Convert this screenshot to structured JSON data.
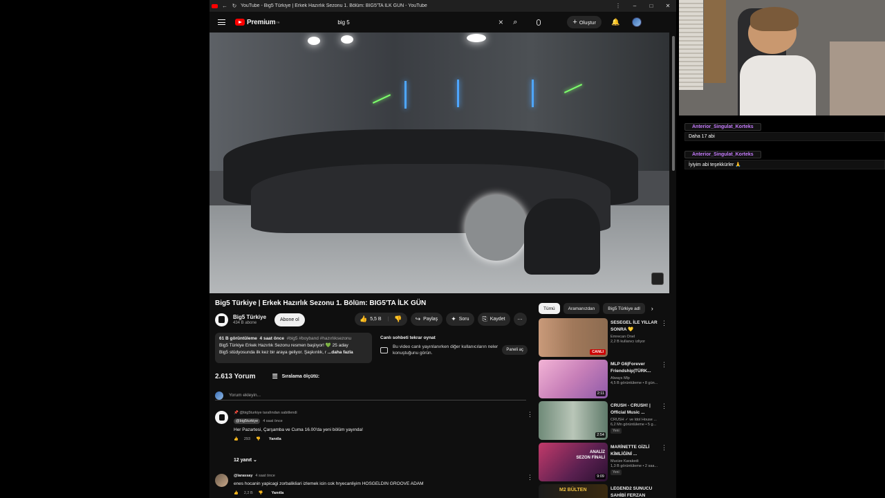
{
  "browser": {
    "title": "YouTube - Big5 Türkiye | Erkek Hazırlık Sezonu 1. Bölüm: BIG5'TA İLK GÜN - YouTube"
  },
  "header": {
    "logo_text": "Premium",
    "logo_sup": "TR",
    "search_query": "big 5",
    "create_label": "Oluştur"
  },
  "video": {
    "title": "Big5 Türkiye | Erkek Hazırlık Sezonu 1. Bölüm: BIG5'TA İLK GÜN",
    "channel": "Big5 Türkiye",
    "subscribers": "434 B abone",
    "subscribe_label": "Abone ol",
    "likes": "5,5 B",
    "share_label": "Paylaş",
    "ask_label": "Soru",
    "save_label": "Kaydet",
    "description": {
      "views": "61 B görüntüleme",
      "age": "4 saat önce",
      "tags": "#big5 #boyband #hazırlıksezonu",
      "line1": "Big5 Türkiye Erkek Hazırlık Sezonu resmen başlıyor! 💚 25 aday",
      "line2": "Big5 stüdyosunda ilk kez bir araya geliyor. Şaşkınlık, r",
      "more": "...daha fazla"
    },
    "live_chat": {
      "title": "Canlı sohbeti tekrar oynat",
      "text": "Bu video canlı yayınlanırken diğer kullanıcıların neler konuştuğunu görün.",
      "button": "Paneli aç"
    }
  },
  "comments": {
    "count": "2.613 Yorum",
    "sort_label": "Sıralama ölçütü:",
    "add_placeholder": "Yorum ekleyin...",
    "items": [
      {
        "pinned": "@big5turkiye tarafından sabitlendi",
        "author": "@big5turkiye",
        "time": "4 saat önce",
        "text": "Her Pazartesi, Çarşamba ve Cuma 16.00'da yeni bölüm yayında!",
        "likes": "293",
        "reply": "Yanıtla",
        "replies": "12 yanıt"
      },
      {
        "author": "@larassay",
        "time": "4 saat önce",
        "text": "enes hocanin yapicagi zorbalikliari izlemek icin cok hryecanliyim HOSGELDIN GROOVE ADAM",
        "likes": "2,2 B",
        "reply": "Yanıtla"
      }
    ]
  },
  "chips": [
    "Tümü",
    "Aramanızdan",
    "Big5 Türkiye adl"
  ],
  "recommendations": [
    {
      "title": "SESEGEL İLE YILLAR SONRA 💛",
      "channel": "Emrecan Önel",
      "meta": "2,2 B kullanıcı izliyor",
      "badge": "CANLI"
    },
    {
      "title": "MLP G6|Forever Friendship|TÜRK...",
      "channel": "Always Mlp",
      "meta": "4,5 B görüntüleme • 8 gün...",
      "duration": "2:11"
    },
    {
      "title": "CRUSH - CRUSH! | Official Music ...",
      "channel": "CRUSH ✓ ve Idol House ...",
      "meta": "6,2 Mn görüntüleme • 5 g...",
      "duration": "2:54",
      "new": "Yeni"
    },
    {
      "title": "MARİNETTE GİZLİ KİMLİĞİNİ ...",
      "channel": "Mucize Karakedi",
      "meta": "1,3 B görüntüleme • 2 saa...",
      "duration": "9:09",
      "new": "Yeni",
      "thumb_text": "ANALİZ SEZON FİNALİ"
    },
    {
      "title": "LEGEND2 SUNUCU SAHİBİ FERZAN",
      "channel": "",
      "meta": "",
      "thumb_text": "M2 BÜLTEN"
    }
  ],
  "stream_chat": [
    {
      "user": "Anterior_Singulat_Korteks",
      "message": "Daha 17 abi"
    },
    {
      "user": "Anterior_Singulat_Korteks",
      "message": "İyiyim abi teşekkürler 🙏"
    }
  ],
  "colors": {
    "yt_bg": "#0f0f0f",
    "accent_red": "#ff0000",
    "chat_user": "#c77dff"
  }
}
